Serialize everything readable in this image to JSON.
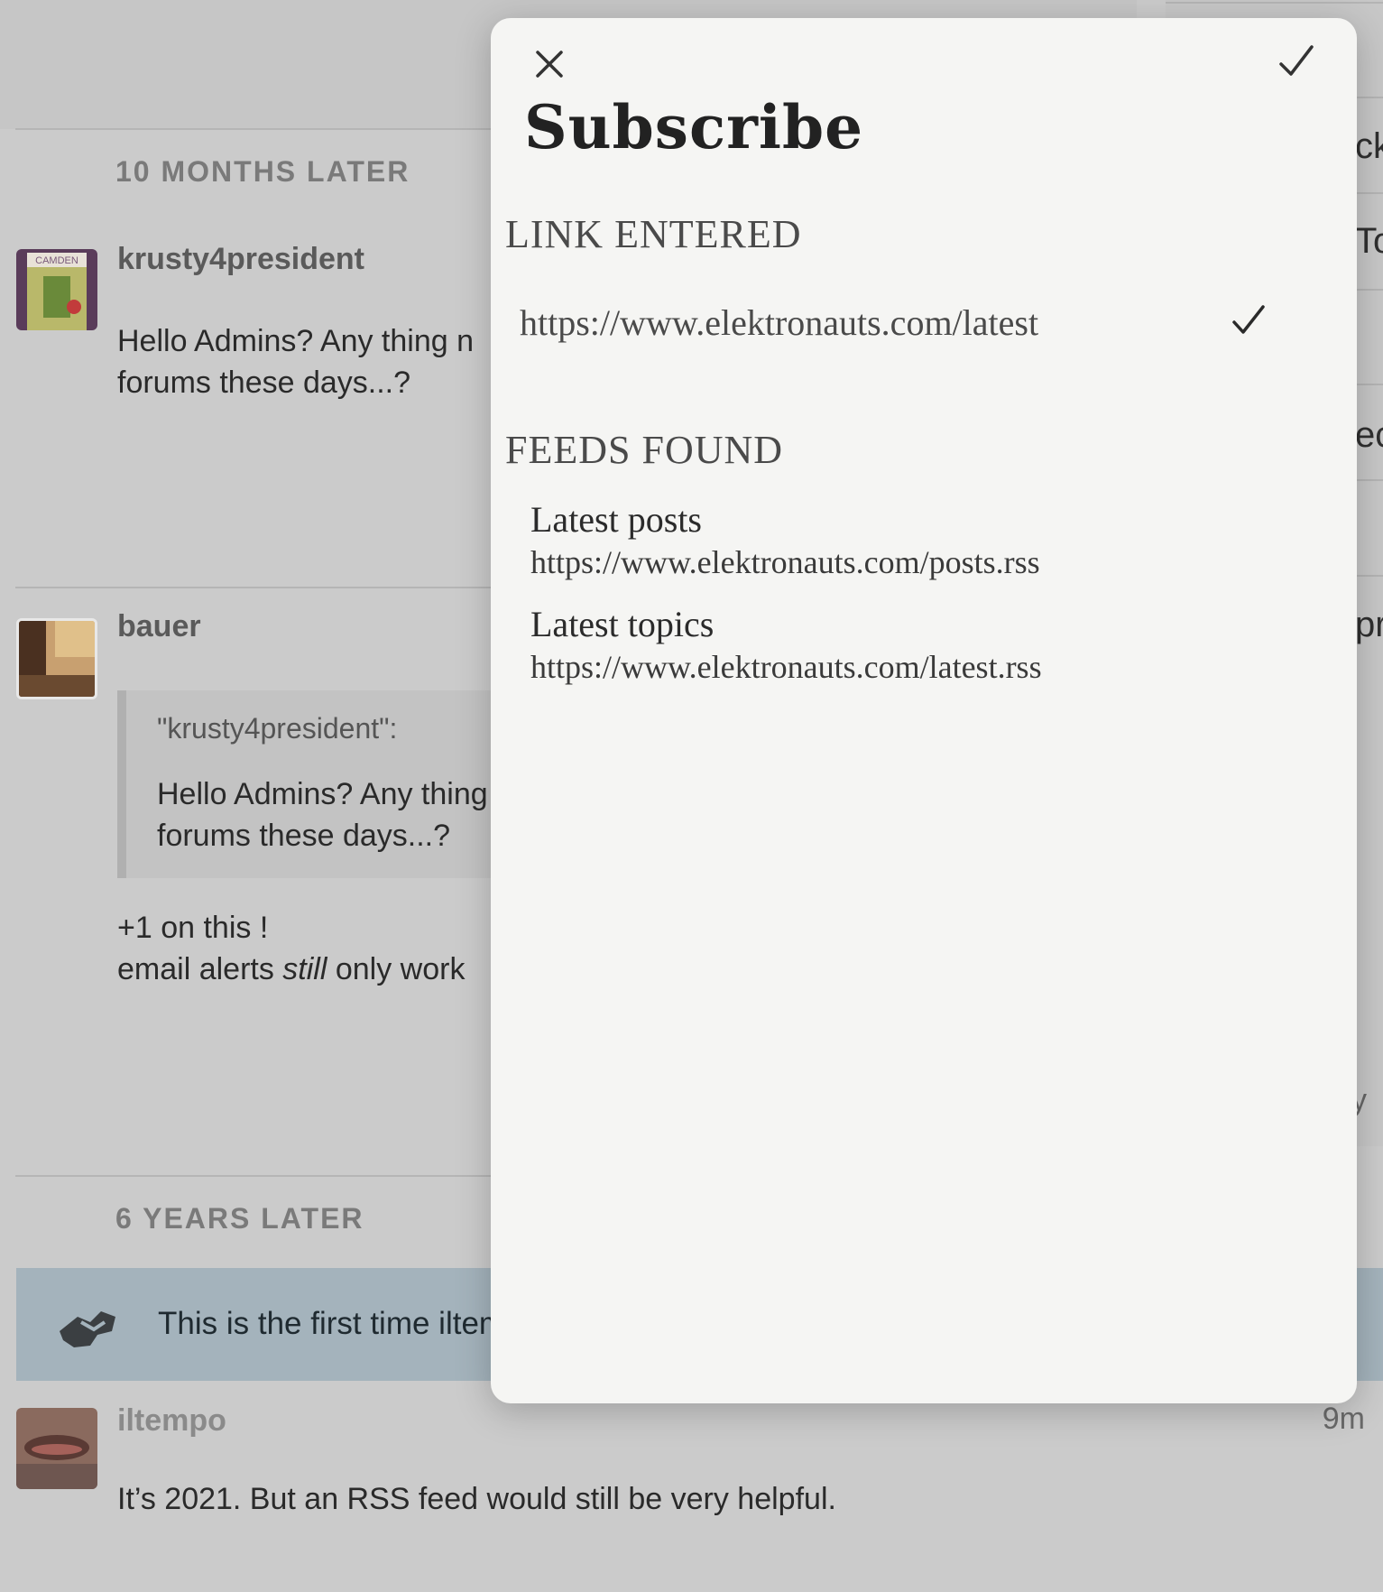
{
  "background": {
    "gap1": "10 MONTHS LATER",
    "post1": {
      "username": "krusty4president",
      "avatar_text": "CAMDEN",
      "lines": [
        "Hello Admins? Any thing n",
        "forums these days...?"
      ]
    },
    "post2": {
      "username": "bauer",
      "quote_author": "\"krusty4president\":",
      "quote_lines": [
        "Hello Admins? Any thing",
        "forums these days...?"
      ],
      "line1": "+1 on this !",
      "line2_pre": "email alerts ",
      "line2_em": "still",
      "line2_post": " only work "
    },
    "gap2": "6 YEARS LATER",
    "notice_text": "This is the first time iltem",
    "post3": {
      "username": "iltempo",
      "time": "9m",
      "text": "It’s 2021. But an RSS feed would still be very helpful."
    },
    "sidebar_fragments": [
      "ck",
      "To",
      "ec",
      "pr",
      "y"
    ]
  },
  "modal": {
    "title": "Subscribe",
    "link_section": "LINK ENTERED",
    "link_url": "https://www.elektronauts.com/latest",
    "feeds_section": "FEEDS FOUND",
    "feeds": [
      {
        "title": "Latest posts",
        "url": "https://www.elektronauts.com/posts.rss"
      },
      {
        "title": "Latest topics",
        "url": "https://www.elektronauts.com/latest.rss"
      }
    ]
  },
  "icons": {
    "close": "close-icon",
    "done": "checkmark-icon",
    "notice": "handshake-icon"
  }
}
